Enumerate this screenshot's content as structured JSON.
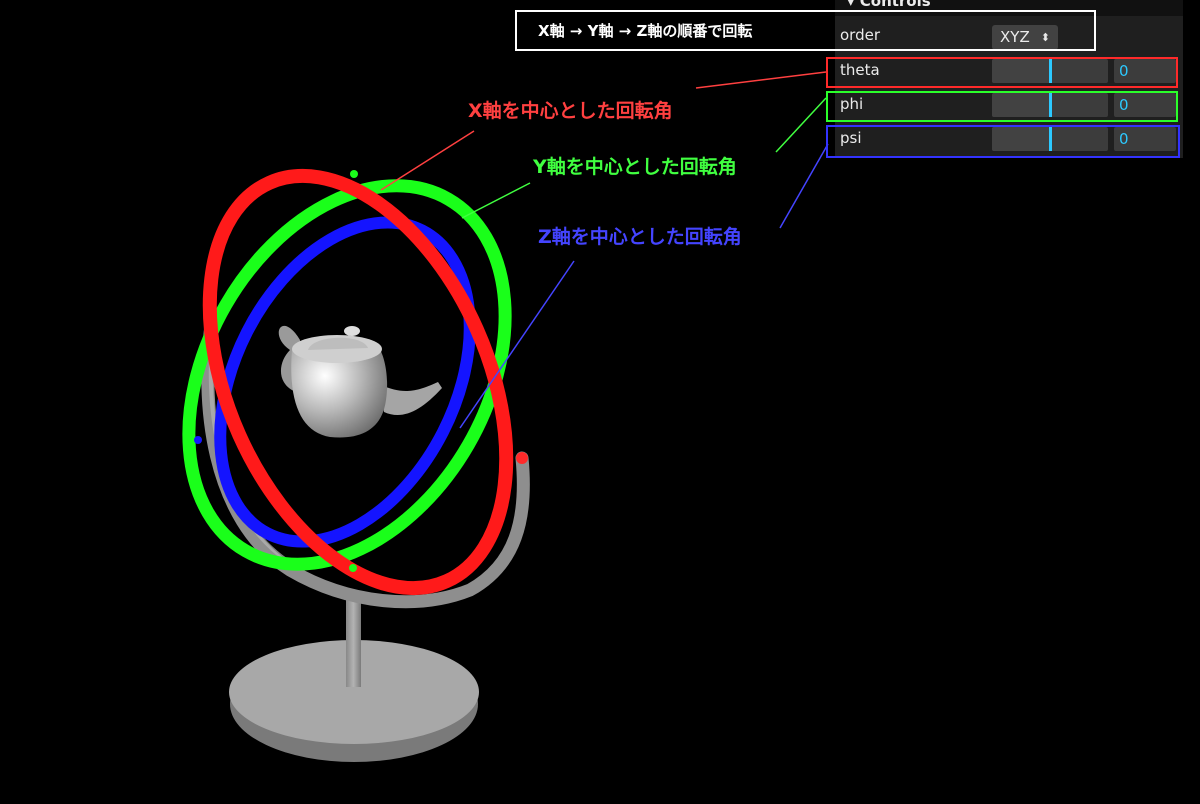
{
  "callout": {
    "text": "X軸 → Y軸 → Z軸の順番で回転"
  },
  "gui": {
    "title": "▾ Controls",
    "order": {
      "label": "order",
      "value": "XYZ",
      "arrow": "⬍"
    },
    "theta": {
      "label": "theta",
      "value": "0",
      "level": 0.5
    },
    "phi": {
      "label": "phi",
      "value": "0",
      "level": 0.5
    },
    "psi": {
      "label": "psi",
      "value": "0",
      "level": 0.5
    }
  },
  "annotations": {
    "x_axis": "X軸を中心とした回転角",
    "y_axis": "Y軸を中心とした回転角",
    "z_axis": "Z軸を中心とした回転角"
  },
  "colors": {
    "x_ring": "#ff1a1a",
    "y_ring": "#1aff1a",
    "z_ring": "#1414ff",
    "x_text": "#ff4040",
    "y_text": "#40ff40",
    "z_text": "#4444ff",
    "accent": "#2cc9ff"
  }
}
